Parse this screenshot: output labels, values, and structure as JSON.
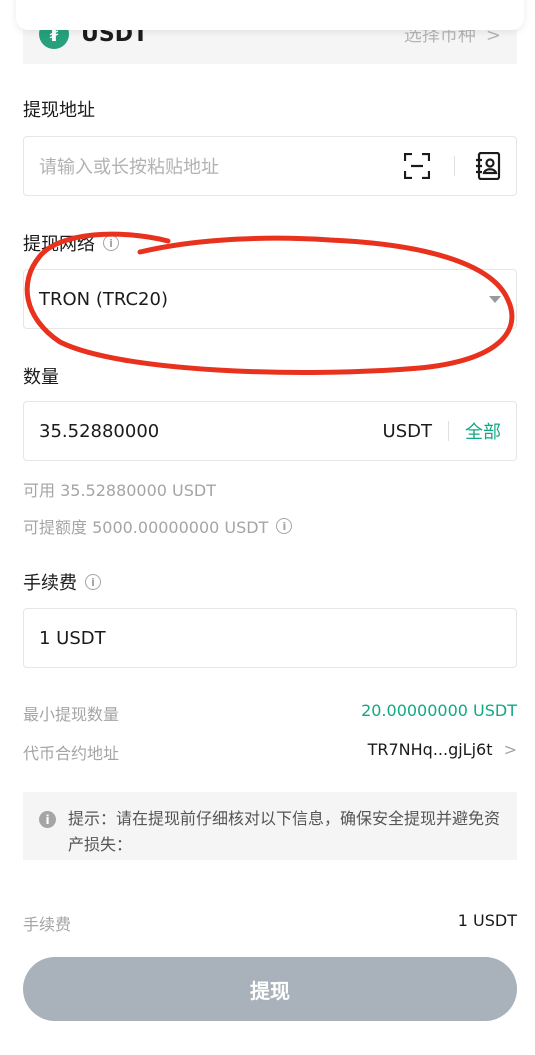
{
  "coin": {
    "icon_letter": "₮",
    "name": "USDT",
    "select_label": "选择币种",
    "select_chevron": ">"
  },
  "address": {
    "label": "提现地址",
    "placeholder": "请输入或长按粘贴地址",
    "scan_icon": "scan-icon",
    "contact_icon": "address-book-icon"
  },
  "network": {
    "label": "提现网络",
    "info_icon": "i",
    "value": "TRON (TRC20)"
  },
  "amount": {
    "label": "数量",
    "value": "35.52880000",
    "unit": "USDT",
    "all_label": "全部"
  },
  "available": {
    "text": "可用 35.52880000 USDT"
  },
  "limit": {
    "text": "可提额度 5000.00000000 USDT",
    "info_icon": "i"
  },
  "fee_field": {
    "label": "手续费",
    "info_icon": "i",
    "value": "1 USDT"
  },
  "min_withdraw": {
    "label": "最小提现数量",
    "value": "20.00000000 USDT"
  },
  "contract": {
    "label": "代币合约地址",
    "value": "TR7NHq...gjLj6t",
    "chevron": ">"
  },
  "notice": {
    "icon": "i",
    "text": "提示：请在提现前仔细核对以下信息，确保安全提现并避免资产损失："
  },
  "fee_summary": {
    "label": "手续费",
    "value": "1 USDT"
  },
  "submit": {
    "label": "提现"
  },
  "colors": {
    "accent_green": "#13a884",
    "annotation_red": "#e8321e",
    "button_disabled": "#a9b2bb",
    "usdt_green": "#26a17b"
  }
}
